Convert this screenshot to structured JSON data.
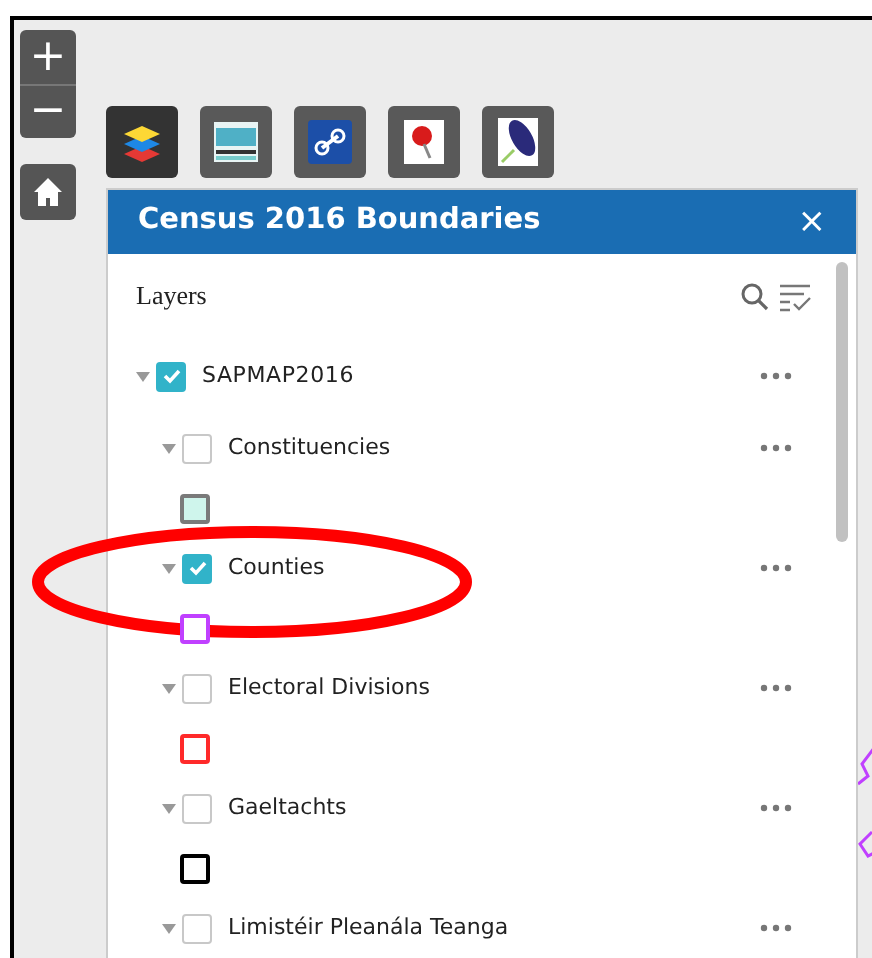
{
  "zoom_controls": [
    {
      "label": "+"
    },
    {
      "label": "−"
    }
  ],
  "toolbar": [
    {
      "kind": "layers",
      "selected": true
    },
    {
      "kind": "census",
      "selected": false
    },
    {
      "kind": "link",
      "selected": false
    },
    {
      "kind": "pin",
      "selected": false
    },
    {
      "kind": "leaf",
      "selected": false
    }
  ],
  "panel": {
    "title": "Census 2016 Boundaries",
    "close": "×",
    "heading": "Layers",
    "layers": [
      {
        "name": "SAPMAP2016",
        "checked": true,
        "expanded": true,
        "children": [
          {
            "name": "Constituencies",
            "checked": false,
            "expanded": true,
            "kind": "fill",
            "color": "#cff5ec"
          },
          {
            "name": "Counties",
            "checked": true,
            "expanded": true,
            "kind": "outline",
            "color": "#c040ff"
          },
          {
            "name": "Electoral Divisions",
            "checked": false,
            "expanded": true,
            "kind": "outline",
            "color": "#ff2a2a"
          },
          {
            "name": "Gaeltachts",
            "checked": false,
            "expanded": true,
            "kind": "outline",
            "color": "#000000"
          },
          {
            "name": "Limistéir Pleanála Teanga",
            "checked": false,
            "expanded": true
          }
        ]
      }
    ]
  }
}
